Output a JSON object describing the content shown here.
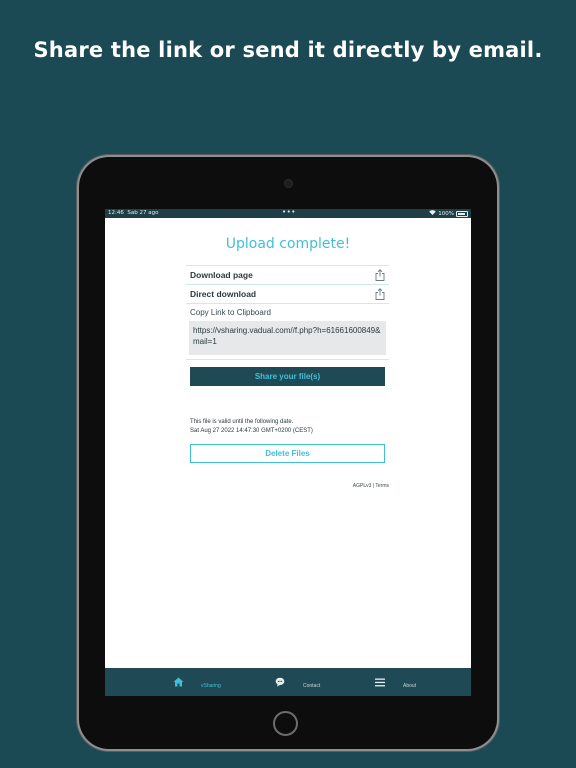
{
  "headline": "Share the link or send it directly by email.",
  "statusbar": {
    "time": "12:46",
    "date": "Sab 27 ago",
    "dots": "•••",
    "battery": "100%"
  },
  "page": {
    "title": "Upload complete!",
    "download_page_label": "Download page",
    "direct_download_label": "Direct download",
    "copy_label": "Copy Link to Clipboard",
    "link_text": "https://vsharing.vadual.com//f.php?h=61661600849&mail=1",
    "share_button": "Share your file(s)",
    "valid_line1": "This file is valid until the following date.",
    "valid_line2": "Sat Aug 27 2022 14:47:30 GMT+0200 (CEST)",
    "delete_button": "Delete Files",
    "footer_links": "AGPLv3 | Terms"
  },
  "tabbar": {
    "items": [
      {
        "label": "vSharing",
        "icon": "home-icon",
        "active": true
      },
      {
        "label": "Contact",
        "icon": "chat-icon",
        "active": false
      },
      {
        "label": "About",
        "icon": "menu-icon",
        "active": false
      }
    ]
  },
  "colors": {
    "background": "#1b4a54",
    "accent": "#3fc0d8",
    "dark_teal": "#1f4a55"
  }
}
